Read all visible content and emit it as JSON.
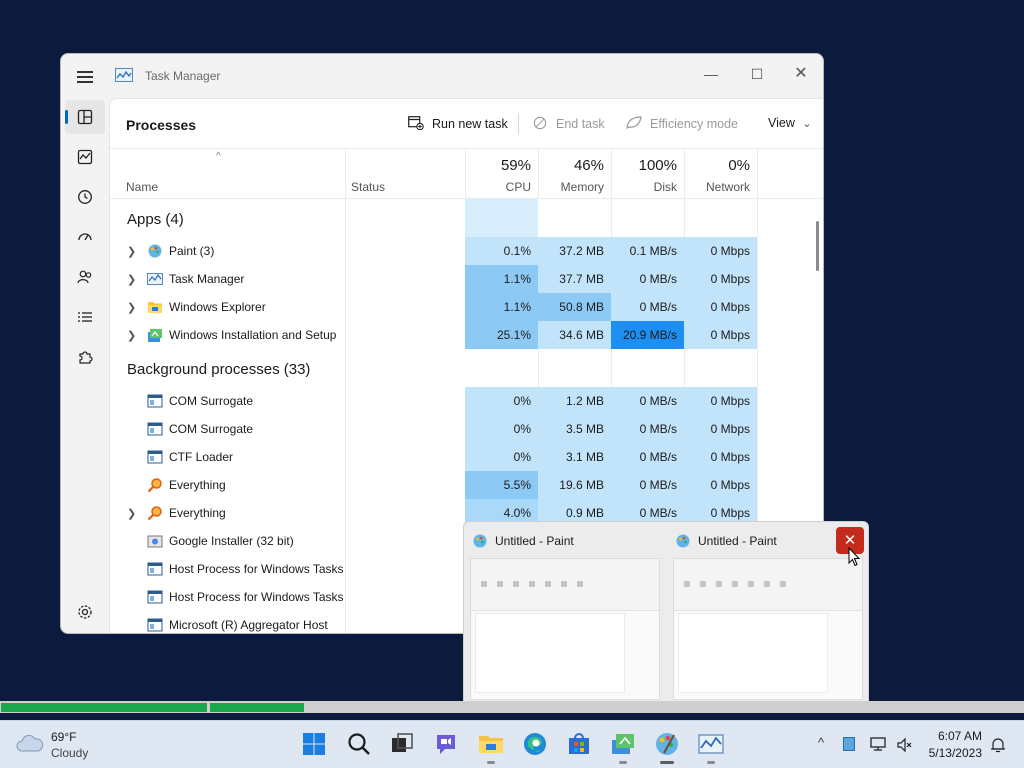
{
  "window": {
    "title": "Task Manager",
    "min_glyph": "—",
    "max_glyph": "☐",
    "close_glyph": "✕"
  },
  "nav": {
    "items": [
      {
        "name": "processes",
        "icon": "processes-icon"
      },
      {
        "name": "performance",
        "icon": "performance-icon"
      },
      {
        "name": "app-history",
        "icon": "history-icon"
      },
      {
        "name": "startup-apps",
        "icon": "speedometer-icon"
      },
      {
        "name": "users",
        "icon": "users-icon"
      },
      {
        "name": "details",
        "icon": "list-icon"
      },
      {
        "name": "services",
        "icon": "puzzle-icon"
      },
      {
        "name": "settings",
        "icon": "gear-icon"
      }
    ]
  },
  "toolbar": {
    "page_title": "Processes",
    "run_new_task": "Run new task",
    "end_task": "End task",
    "efficiency_mode": "Efficiency mode",
    "view": "View",
    "view_chevron": "⌄"
  },
  "columns": {
    "name": "Name",
    "status": "Status",
    "cpu_pct": "59%",
    "cpu": "CPU",
    "memory_pct": "46%",
    "memory": "Memory",
    "disk_pct": "100%",
    "disk": "Disk",
    "network_pct": "0%",
    "network": "Network",
    "sort_arrow": "^"
  },
  "groups": {
    "apps": "Apps (4)",
    "background": "Background processes (33)"
  },
  "apps": [
    {
      "name": "Paint (3)",
      "cpu": "0.1%",
      "memory": "37.2 MB",
      "disk": "0.1 MB/s",
      "network": "0 Mbps",
      "expandable": true
    },
    {
      "name": "Task Manager",
      "cpu": "1.1%",
      "memory": "37.7 MB",
      "disk": "0 MB/s",
      "network": "0 Mbps",
      "expandable": true
    },
    {
      "name": "Windows Explorer",
      "cpu": "1.1%",
      "memory": "50.8 MB",
      "disk": "0 MB/s",
      "network": "0 Mbps",
      "expandable": true
    },
    {
      "name": "Windows Installation and Setup",
      "cpu": "25.1%",
      "memory": "34.6 MB",
      "disk": "20.9 MB/s",
      "network": "0 Mbps",
      "expandable": true
    }
  ],
  "background": [
    {
      "name": "COM Surrogate",
      "cpu": "0%",
      "memory": "1.2 MB",
      "disk": "0 MB/s",
      "network": "0 Mbps"
    },
    {
      "name": "COM Surrogate",
      "cpu": "0%",
      "memory": "3.5 MB",
      "disk": "0 MB/s",
      "network": "0 Mbps"
    },
    {
      "name": "CTF Loader",
      "cpu": "0%",
      "memory": "3.1 MB",
      "disk": "0 MB/s",
      "network": "0 Mbps"
    },
    {
      "name": "Everything",
      "cpu": "5.5%",
      "memory": "19.6 MB",
      "disk": "0 MB/s",
      "network": "0 Mbps"
    },
    {
      "name": "Everything",
      "cpu": "4.0%",
      "memory": "0.9 MB",
      "disk": "0 MB/s",
      "network": "0 Mbps"
    },
    {
      "name": "Google Installer (32 bit)"
    },
    {
      "name": "Host Process for Windows Tasks"
    },
    {
      "name": "Host Process for Windows Tasks"
    },
    {
      "name": "Microsoft (R) Aggregator Host"
    }
  ],
  "preview": {
    "thumb1_title": "Untitled - Paint",
    "thumb2_title": "Untitled - Paint",
    "close_glyph": "✕"
  },
  "taskbar": {
    "weather_temp": "69°F",
    "weather_cond": "Cloudy",
    "clock_time": "6:07 AM",
    "clock_date": "5/13/2023",
    "tray_chevron": "^"
  },
  "colors": {
    "accent": "#0067c0",
    "heat_low": "#d8eefc",
    "heat_high": "#1e8ff0",
    "close_red": "#c42b1c",
    "progress_green": "#1aa64a"
  }
}
